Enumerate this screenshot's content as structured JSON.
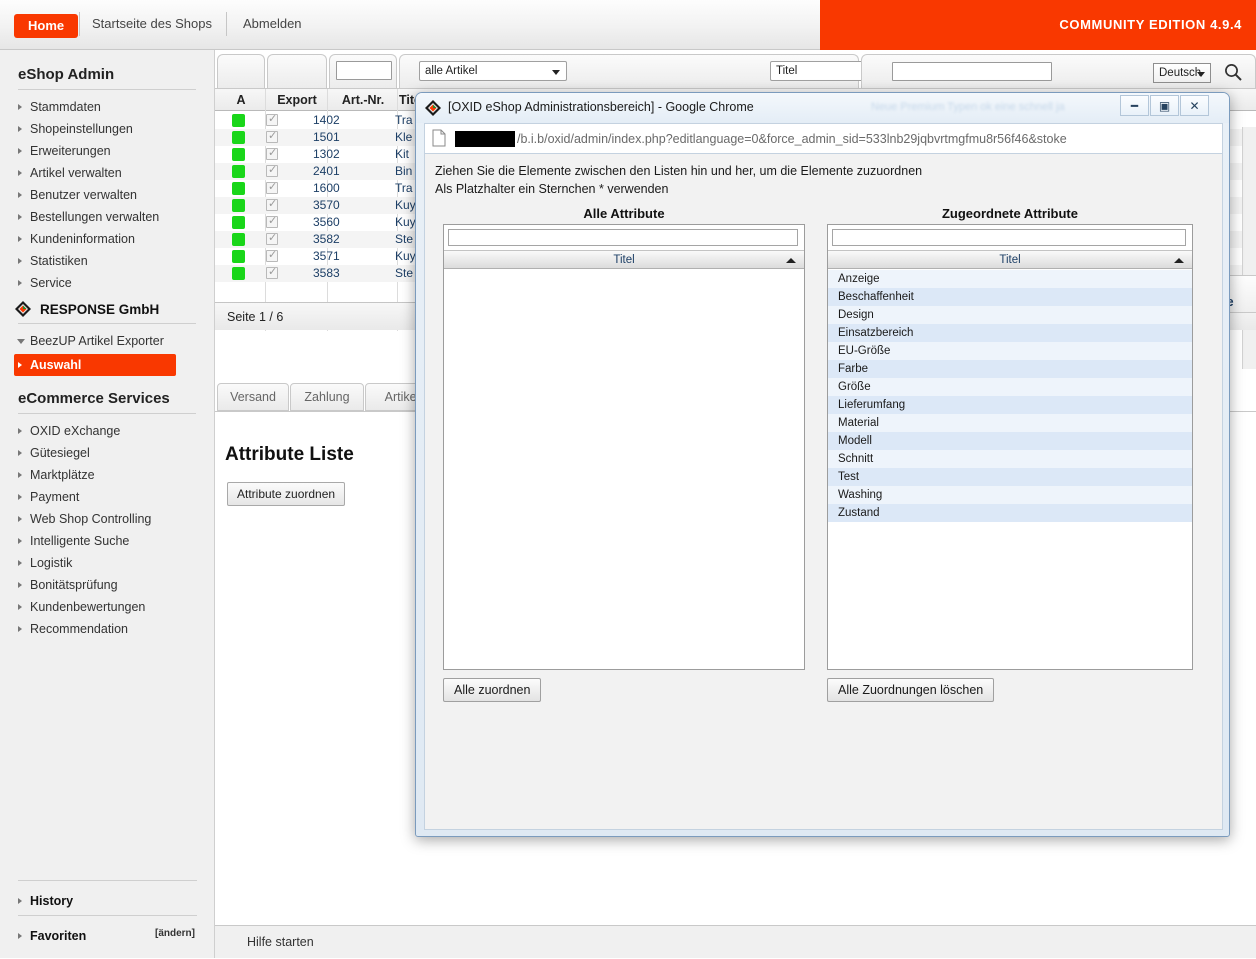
{
  "topbar": {
    "home_label": "Home",
    "shop_home_label": "Startseite des Shops",
    "logout_label": "Abmelden",
    "edition_label": "COMMUNITY EDITION 4.9.4",
    "accent_color": "#f93800"
  },
  "sidebar": {
    "title": "eShop Admin",
    "items": [
      {
        "label": "Stammdaten"
      },
      {
        "label": "Shopeinstellungen"
      },
      {
        "label": "Erweiterungen"
      },
      {
        "label": "Artikel verwalten"
      },
      {
        "label": "Benutzer verwalten"
      },
      {
        "label": "Bestellungen verwalten"
      },
      {
        "label": "Kundeninformation"
      },
      {
        "label": "Statistiken"
      },
      {
        "label": "Service"
      }
    ],
    "partner_label": "RESPONSE GmbH",
    "exporter_label": "BeezUP Artikel Exporter",
    "exporter_selected_label": "Auswahl",
    "services_title": "eCommerce Services",
    "service_items": [
      {
        "label": "OXID eXchange"
      },
      {
        "label": "Gütesiegel"
      },
      {
        "label": "Marktplätze"
      },
      {
        "label": "Payment"
      },
      {
        "label": "Web Shop Controlling"
      },
      {
        "label": "Intelligente Suche"
      },
      {
        "label": "Logistik"
      },
      {
        "label": "Bonitätsprüfung"
      },
      {
        "label": "Kundenbewertungen"
      },
      {
        "label": "Recommendation"
      }
    ],
    "history_label": "History",
    "favorites_label": "Favoriten",
    "favorites_edit_label": "[ändern]"
  },
  "toolbar": {
    "artnr_filter_value": "",
    "category_select_value": "alle Artikel",
    "field_select_value": "Titel",
    "filter3_value": "",
    "filter4_value": "",
    "language_select_value": "Deutsch",
    "search_icon": "search-icon"
  },
  "table": {
    "columns": [
      "A",
      "Export",
      "Art.-Nr.",
      "Titel"
    ],
    "rows": [
      {
        "status": "green",
        "export": true,
        "artnr": "1402",
        "title": "Tra"
      },
      {
        "status": "green",
        "export": true,
        "artnr": "1501",
        "title": "Kle"
      },
      {
        "status": "green",
        "export": true,
        "artnr": "1302",
        "title": "Kit"
      },
      {
        "status": "green",
        "export": true,
        "artnr": "2401",
        "title": "Bin"
      },
      {
        "status": "green",
        "export": true,
        "artnr": "1600",
        "title": "Tra"
      },
      {
        "status": "green",
        "export": true,
        "artnr": "3570",
        "title": "Kuy"
      },
      {
        "status": "green",
        "export": true,
        "artnr": "3560",
        "title": "Kuy"
      },
      {
        "status": "green",
        "export": true,
        "artnr": "3582",
        "title": "Ste"
      },
      {
        "status": "green",
        "export": true,
        "artnr": "3571",
        "title": "Kuy"
      },
      {
        "status": "green",
        "export": true,
        "artnr": "3583",
        "title": "Ste"
      }
    ],
    "pager_label": "Seite 1 / 6",
    "edge_tab_label": "ite"
  },
  "lower_panel": {
    "tabs": [
      {
        "label": "Versand"
      },
      {
        "label": "Zahlung"
      },
      {
        "label": "Artikel"
      }
    ],
    "heading": "Attribute Liste",
    "assign_button_label": "Attribute zuordnen"
  },
  "help_bar": {
    "label": "Hilfe starten"
  },
  "popup": {
    "title": "[OXID eShop Administrationsbereich] - Google Chrome",
    "favicon": "oxid-diamond-icon",
    "ghost_text": "Neue Premium Typen ok eine  schnell ja",
    "window_buttons": {
      "minimize": "minimize-icon",
      "maximize": "maximize-icon",
      "close": "close-icon"
    },
    "url_text": "/b.i.b/oxid/admin/index.php?editlanguage=0&force_admin_sid=533lnb29jqbvrtmgfmu8r56f46&stoke",
    "url_redacted": true,
    "instruction_line1": "Ziehen Sie die Elemente zwischen den Listen hin und her, um die Elemente zuzuordnen",
    "instruction_line2": "Als Platzhalter ein Sternchen * verwenden",
    "left_list": {
      "heading": "Alle Attribute",
      "filter_value": "",
      "column_header": "Titel",
      "sort_direction": "asc",
      "rows": [],
      "button_label": "Alle zuordnen"
    },
    "right_list": {
      "heading": "Zugeordnete Attribute",
      "filter_value": "",
      "column_header": "Titel",
      "sort_direction": "asc",
      "rows": [
        "Anzeige",
        "Beschaffenheit",
        "Design",
        "Einsatzbereich",
        "EU-Größe",
        "Farbe",
        "Größe",
        "Lieferumfang",
        "Material",
        "Modell",
        "Schnitt",
        "Test",
        "Washing",
        "Zustand"
      ],
      "button_label": "Alle Zuordnungen löschen"
    }
  }
}
